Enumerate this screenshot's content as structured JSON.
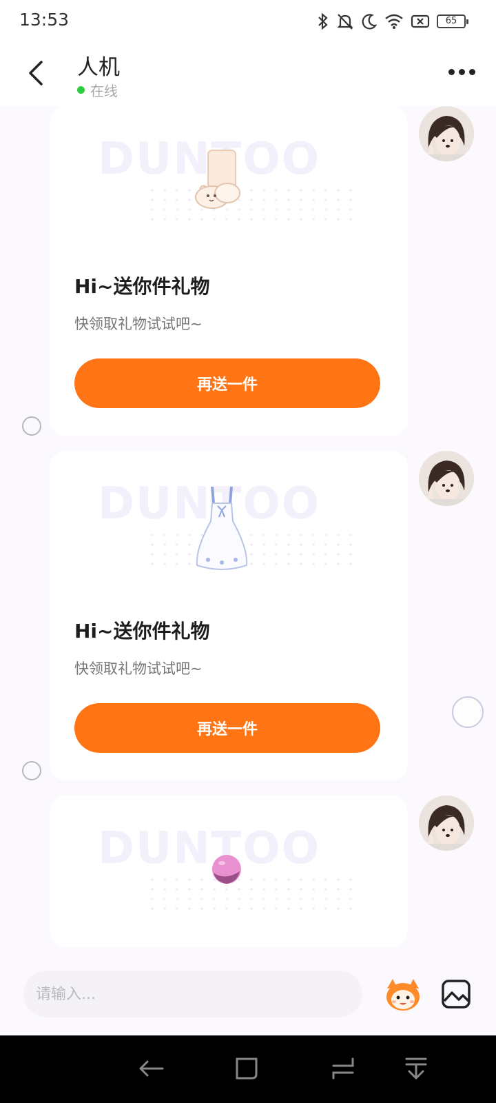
{
  "status_bar": {
    "time": "13:53",
    "battery": "65",
    "icons": [
      "bluetooth-icon",
      "bell-off-icon",
      "moon-icon",
      "wifi-icon",
      "sim-none-icon",
      "battery-icon"
    ]
  },
  "header": {
    "title": "人机",
    "status": "在线",
    "status_color": "#2ecc40"
  },
  "messages": [
    {
      "title": "Hi~送你件礼物",
      "subtitle": "快领取礼物试试吧~",
      "button": "再送一件",
      "gift_icon": "socks-icon"
    },
    {
      "title": "Hi~送你件礼物",
      "subtitle": "快领取礼物试试吧~",
      "button": "再送一件",
      "gift_icon": "dress-icon"
    },
    {
      "gift_icon": "ball-icon"
    }
  ],
  "input": {
    "placeholder": "请输入..."
  },
  "colors": {
    "accent": "#ff7414",
    "background": "#fbf9fd"
  }
}
